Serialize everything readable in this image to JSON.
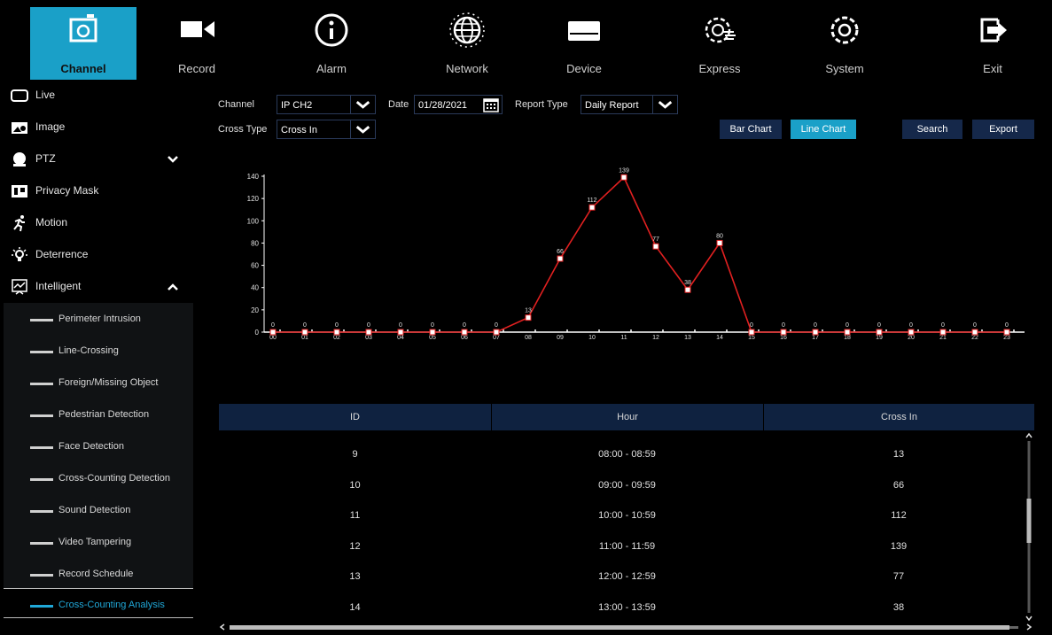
{
  "topbar": {
    "items": [
      {
        "label": "Channel",
        "icon": "camera-icon"
      },
      {
        "label": "Record",
        "icon": "video-camera-icon"
      },
      {
        "label": "Alarm",
        "icon": "info-icon"
      },
      {
        "label": "Network",
        "icon": "globe-icon"
      },
      {
        "label": "Device",
        "icon": "hard-drive-icon"
      },
      {
        "label": "Express",
        "icon": "gear-hand-icon"
      },
      {
        "label": "System",
        "icon": "gear-icon"
      },
      {
        "label": "Exit",
        "icon": "exit-icon"
      }
    ],
    "active": "Channel"
  },
  "sidebar": {
    "items": [
      {
        "label": "Live",
        "icon": "monitor-icon"
      },
      {
        "label": "Image",
        "icon": "image-settings-icon"
      },
      {
        "label": "PTZ",
        "icon": "ptz-camera-icon"
      },
      {
        "label": "Privacy Mask",
        "icon": "privacy-mask-icon"
      },
      {
        "label": "Motion",
        "icon": "running-person-icon"
      },
      {
        "label": "Deterrence",
        "icon": "light-bulb-icon"
      },
      {
        "label": "Intelligent",
        "icon": "intelligent-icon"
      }
    ],
    "sub_items": [
      {
        "label": "Perimeter Intrusion"
      },
      {
        "label": "Line-Crossing"
      },
      {
        "label": "Foreign/Missing Object"
      },
      {
        "label": "Pedestrian Detection"
      },
      {
        "label": "Face Detection"
      },
      {
        "label": "Cross-Counting Detection"
      },
      {
        "label": "Sound Detection"
      },
      {
        "label": "Video Tampering"
      },
      {
        "label": "Record Schedule"
      },
      {
        "label": "Cross-Counting Analysis"
      }
    ],
    "active_sub": "Cross-Counting Analysis"
  },
  "form": {
    "channel_label": "Channel",
    "channel_value": "IP CH2",
    "date_label": "Date",
    "date_value": "01/28/2021",
    "report_type_label": "Report Type",
    "report_type_value": "Daily Report",
    "cross_type_label": "Cross Type",
    "cross_type_value": "Cross In"
  },
  "buttons": {
    "bar_chart": "Bar Chart",
    "line_chart": "Line Chart",
    "search": "Search",
    "export": "Export"
  },
  "colors": {
    "accent": "#1aa0c8",
    "line": "#e02020",
    "header_bg": "#0f2240"
  },
  "chart_data": {
    "type": "line",
    "x": [
      "00",
      "01",
      "02",
      "03",
      "04",
      "05",
      "06",
      "07",
      "08",
      "09",
      "10",
      "11",
      "12",
      "13",
      "14",
      "15",
      "16",
      "17",
      "18",
      "19",
      "20",
      "21",
      "22",
      "23"
    ],
    "series": [
      {
        "values": [
          0,
          0,
          0,
          0,
          0,
          0,
          0,
          0,
          13,
          66,
          112,
          139,
          77,
          38,
          80,
          0,
          0,
          0,
          0,
          0,
          0,
          0,
          0,
          0
        ]
      }
    ],
    "y_ticks": [
      0,
      20,
      40,
      60,
      80,
      100,
      120,
      140
    ],
    "ylim": [
      0,
      140
    ],
    "grid": false
  },
  "table": {
    "columns": [
      "ID",
      "Hour",
      "Cross In"
    ],
    "rows": [
      [
        "9",
        "08:00 - 08:59",
        "13"
      ],
      [
        "10",
        "09:00 - 09:59",
        "66"
      ],
      [
        "11",
        "10:00 - 10:59",
        "112"
      ],
      [
        "12",
        "11:00 - 11:59",
        "139"
      ],
      [
        "13",
        "12:00 - 12:59",
        "77"
      ],
      [
        "14",
        "13:00 - 13:59",
        "38"
      ]
    ]
  }
}
